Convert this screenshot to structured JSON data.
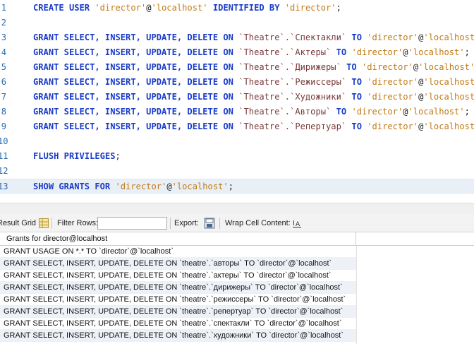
{
  "editor": {
    "lines": [
      {
        "num": "1",
        "tokens": [
          [
            "kw",
            "CREATE USER "
          ],
          [
            "str",
            "'director'"
          ],
          [
            "at",
            "@"
          ],
          [
            "str",
            "'localhost'"
          ],
          [
            "kw",
            " IDENTIFIED BY "
          ],
          [
            "str",
            "'director'"
          ],
          [
            "pl",
            ";"
          ]
        ]
      },
      {
        "num": "2",
        "tokens": []
      },
      {
        "num": "3",
        "tokens": [
          [
            "kw",
            "GRANT SELECT, INSERT, UPDATE, DELETE ON "
          ],
          [
            "bq",
            "`Theatre`.`Спектакли`"
          ],
          [
            "kw",
            " TO "
          ],
          [
            "str",
            "'director'"
          ],
          [
            "at",
            "@"
          ],
          [
            "str",
            "'localhost'"
          ],
          [
            "pl",
            ";"
          ]
        ]
      },
      {
        "num": "4",
        "tokens": [
          [
            "kw",
            "GRANT SELECT, INSERT, UPDATE, DELETE ON "
          ],
          [
            "bq",
            "`Theatre`.`Актеры`"
          ],
          [
            "kw",
            " TO "
          ],
          [
            "str",
            "'director'"
          ],
          [
            "at",
            "@"
          ],
          [
            "str",
            "'localhost'"
          ],
          [
            "pl",
            ";"
          ]
        ]
      },
      {
        "num": "5",
        "tokens": [
          [
            "kw",
            "GRANT SELECT, INSERT, UPDATE, DELETE ON "
          ],
          [
            "bq",
            "`Theatre`.`Дирижеры`"
          ],
          [
            "kw",
            " TO "
          ],
          [
            "str",
            "'director'"
          ],
          [
            "at",
            "@"
          ],
          [
            "str",
            "'localhost'"
          ],
          [
            "pl",
            ";"
          ]
        ]
      },
      {
        "num": "6",
        "tokens": [
          [
            "kw",
            "GRANT SELECT, INSERT, UPDATE, DELETE ON "
          ],
          [
            "bq",
            "`Theatre`.`Режиссеры`"
          ],
          [
            "kw",
            " TO "
          ],
          [
            "str",
            "'director'"
          ],
          [
            "at",
            "@"
          ],
          [
            "str",
            "'localhost'"
          ],
          [
            "pl",
            ";"
          ]
        ]
      },
      {
        "num": "7",
        "tokens": [
          [
            "kw",
            "GRANT SELECT, INSERT, UPDATE, DELETE ON "
          ],
          [
            "bq",
            "`Theatre`.`Художники`"
          ],
          [
            "kw",
            " TO "
          ],
          [
            "str",
            "'director'"
          ],
          [
            "at",
            "@"
          ],
          [
            "str",
            "'localhost'"
          ],
          [
            "pl",
            ";"
          ]
        ]
      },
      {
        "num": "8",
        "tokens": [
          [
            "kw",
            "GRANT SELECT, INSERT, UPDATE, DELETE ON "
          ],
          [
            "bq",
            "`Theatre`.`Авторы`"
          ],
          [
            "kw",
            " TO "
          ],
          [
            "str",
            "'director'"
          ],
          [
            "at",
            "@"
          ],
          [
            "str",
            "'localhost'"
          ],
          [
            "pl",
            ";"
          ]
        ]
      },
      {
        "num": "9",
        "tokens": [
          [
            "kw",
            "GRANT SELECT, INSERT, UPDATE, DELETE ON "
          ],
          [
            "bq",
            "`Theatre`.`Репертуар`"
          ],
          [
            "kw",
            " TO "
          ],
          [
            "str",
            "'director'"
          ],
          [
            "at",
            "@"
          ],
          [
            "str",
            "'localhost'"
          ],
          [
            "pl",
            ";"
          ]
        ]
      },
      {
        "num": "10",
        "tokens": []
      },
      {
        "num": "11",
        "tokens": [
          [
            "kw",
            "FLUSH PRIVILEGES"
          ],
          [
            "pl",
            ";"
          ]
        ]
      },
      {
        "num": "12",
        "tokens": []
      },
      {
        "num": "13",
        "tokens": [
          [
            "kw",
            "SHOW GRANTS FOR "
          ],
          [
            "str",
            "'director'"
          ],
          [
            "at",
            "@"
          ],
          [
            "str",
            "'localhost'"
          ],
          [
            "pl",
            ";"
          ]
        ],
        "current": true
      }
    ],
    "colors": {
      "keyword": "#1a3cc8",
      "string": "#c27a16",
      "current_line": "#e9eff6"
    }
  },
  "toolbar": {
    "result_grid_label": "Result Grid",
    "filter_rows_label": "Filter Rows:",
    "filter_rows_value": "",
    "export_label": "Export:",
    "wrap_label": "Wrap Cell Content:",
    "icons": [
      "grid-icon",
      "export-icon",
      "wrap-icon"
    ]
  },
  "grid": {
    "column_header": "Grants for director@localhost",
    "rows": [
      "GRANT USAGE ON *.* TO `director`@`localhost`",
      "GRANT SELECT, INSERT, UPDATE, DELETE ON `theatre`.`авторы` TO `director`@`localhost`",
      "GRANT SELECT, INSERT, UPDATE, DELETE ON `theatre`.`актеры` TO `director`@`localhost`",
      "GRANT SELECT, INSERT, UPDATE, DELETE ON `theatre`.`дирижеры` TO `director`@`localhost`",
      "GRANT SELECT, INSERT, UPDATE, DELETE ON `theatre`.`режиссеры` TO `director`@`localhost`",
      "GRANT SELECT, INSERT, UPDATE, DELETE ON `theatre`.`репертуар` TO `director`@`localhost`",
      "GRANT SELECT, INSERT, UPDATE, DELETE ON `theatre`.`спектакли` TO `director`@`localhost`",
      "GRANT SELECT, INSERT, UPDATE, DELETE ON `theatre`.`художники` TO `director`@`localhost`"
    ]
  }
}
